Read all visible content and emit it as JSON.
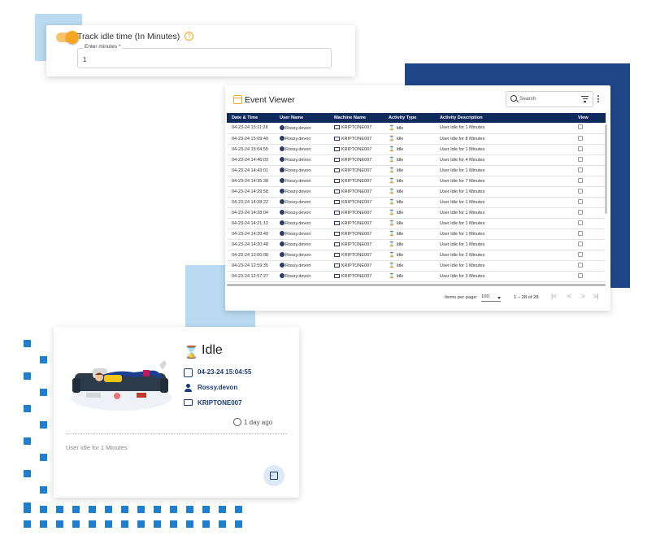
{
  "track_card": {
    "label": "Track idle time (In Minutes)",
    "help_glyph": "?",
    "field_label": "Enter minutes *",
    "field_value": "1",
    "toggle_on": true
  },
  "event_viewer": {
    "title": "Event Viewer",
    "search_placeholder": "Search",
    "columns": [
      "Date & Time",
      "User Name",
      "Machine Name",
      "Activity Type",
      "Activity Description",
      "View"
    ],
    "rows": [
      {
        "date": "04-23-24 15:11:28",
        "user": "Rossy.devon",
        "machine": "KRIPTONE007",
        "type": "Idle",
        "desc": "User Idle for 1 Minutes"
      },
      {
        "date": "04-23-24 15:09:40",
        "user": "Rossy.devon",
        "machine": "KRIPTONE007",
        "type": "Idle",
        "desc": "User Idle for 8 Minutes"
      },
      {
        "date": "04-23-24 15:04:55",
        "user": "Rossy.devon",
        "machine": "KRIPTONE007",
        "type": "Idle",
        "desc": "User Idle for 1 Minutes"
      },
      {
        "date": "04-23-24 14:46:03",
        "user": "Rossy.devon",
        "machine": "KRIPTONE007",
        "type": "Idle",
        "desc": "User Idle for 4 Minutes"
      },
      {
        "date": "04-23-24 14:43:01",
        "user": "Rossy.devon",
        "machine": "KRIPTONE007",
        "type": "Idle",
        "desc": "User Idle for 1 Minutes"
      },
      {
        "date": "04-23-24 14:35:38",
        "user": "Rossy.devon",
        "machine": "KRIPTONE007",
        "type": "Idle",
        "desc": "User Idle for 7 Minutes"
      },
      {
        "date": "04-23-24 14:29:58",
        "user": "Rossy.devon",
        "machine": "KRIPTONE007",
        "type": "Idle",
        "desc": "User Idle for 1 Minutes"
      },
      {
        "date": "04-23-24 14:28:22",
        "user": "Rossy.devon",
        "machine": "KRIPTONE007",
        "type": "Idle",
        "desc": "User Idle for 1 Minutes"
      },
      {
        "date": "04-23-24 14:28:04",
        "user": "Rossy.devon",
        "machine": "KRIPTONE007",
        "type": "Idle",
        "desc": "User Idle for 1 Minutes"
      },
      {
        "date": "04-23-24 14:21:12",
        "user": "Rossy.devon",
        "machine": "KRIPTONE007",
        "type": "Idle",
        "desc": "User Idle for 1 Minutes"
      },
      {
        "date": "04-23-24 14:20:49",
        "user": "Rossy.devon",
        "machine": "KRIPTONE007",
        "type": "Idle",
        "desc": "User Idle for 1 Minutes"
      },
      {
        "date": "04-23-24 14:20:48",
        "user": "Rossy.devon",
        "machine": "KRIPTONE007",
        "type": "Idle",
        "desc": "User Idle for 1 Minutes"
      },
      {
        "date": "04-23-24 13:00:08",
        "user": "Rossy.devon",
        "machine": "KRIPTONE007",
        "type": "Idle",
        "desc": "User Idle for 2 Minutes"
      },
      {
        "date": "04-23-24 12:59:35",
        "user": "Rossy.devon",
        "machine": "KRIPTONE007",
        "type": "Idle",
        "desc": "User Idle for 1 Minutes"
      },
      {
        "date": "04-23-24 12:57:27",
        "user": "Rossy.devon",
        "machine": "KRIPTONE007",
        "type": "Idle",
        "desc": "User Idle for 3 Minutes"
      }
    ],
    "items_per_page_label": "Items per page:",
    "items_per_page_value": "100",
    "range_label": "1 – 28 of 28",
    "pager_first": "|<",
    "pager_prev": "<",
    "pager_next": ">",
    "pager_last": ">|"
  },
  "idle_card": {
    "title": "Idle",
    "datetime": "04-23-24 15:04:55",
    "user": "Rossy.devon",
    "machine": "KRIPTONE007",
    "ago": "1 day ago",
    "description": "User Idle for 1 Minutes"
  },
  "colors": {
    "accent_orange": "#f5a623",
    "navy": "#1f4788",
    "header_navy": "#0f2b5b",
    "light_blue": "#b9daf0",
    "dot_blue": "#1e7fd0"
  }
}
